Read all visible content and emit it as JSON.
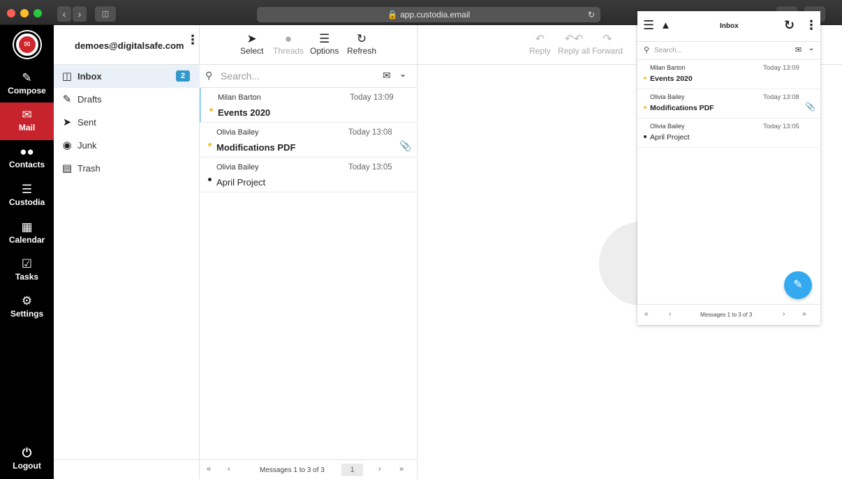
{
  "browser": {
    "url": "app.custodia.email"
  },
  "appnav": {
    "items": [
      {
        "label": "Compose",
        "icon": "compose-icon"
      },
      {
        "label": "Mail",
        "icon": "mail-icon"
      },
      {
        "label": "Contacts",
        "icon": "contacts-icon"
      },
      {
        "label": "Custodia",
        "icon": "menu-icon"
      },
      {
        "label": "Calendar",
        "icon": "calendar-icon"
      },
      {
        "label": "Tasks",
        "icon": "tasks-icon"
      },
      {
        "label": "Settings",
        "icon": "gear-icon"
      }
    ],
    "logout": "Logout",
    "accent": "#c7232d"
  },
  "account": {
    "email": "demoes@digitalsafe.com"
  },
  "folders": [
    {
      "label": "Inbox",
      "icon": "inbox-icon",
      "unread": "2"
    },
    {
      "label": "Drafts",
      "icon": "pencil-icon"
    },
    {
      "label": "Sent",
      "icon": "paper-plane-icon"
    },
    {
      "label": "Junk",
      "icon": "fire-icon"
    },
    {
      "label": "Trash",
      "icon": "trash-icon"
    }
  ],
  "list_toolbar": {
    "select": "Select",
    "threads": "Threads",
    "options": "Options",
    "refresh": "Refresh"
  },
  "search": {
    "placeholder": "Search..."
  },
  "messages": [
    {
      "from": "Milan Barton",
      "date": "Today 13:09",
      "subject": "Events 2020",
      "unread": true,
      "attachment": false
    },
    {
      "from": "Olivia Bailey",
      "date": "Today 13:08",
      "subject": "Modifications PDF",
      "unread": true,
      "attachment": true
    },
    {
      "from": "Olivia Bailey",
      "date": "Today 13:05",
      "subject": "April Project",
      "unread": false,
      "attachment": false
    }
  ],
  "pager": {
    "info": "Messages 1 to 3 of 3",
    "page": "1"
  },
  "reader_toolbar": {
    "reply": "Reply",
    "reply_all": "Reply all",
    "forward": "Forward"
  },
  "mobile": {
    "title": "Inbox",
    "search_placeholder": "Search...",
    "pager_info": "Messages 1 to 3 of 3"
  },
  "colors": {
    "unread_dot": "#f5c342",
    "badge": "#3399cc",
    "fab": "#33aaf0"
  }
}
